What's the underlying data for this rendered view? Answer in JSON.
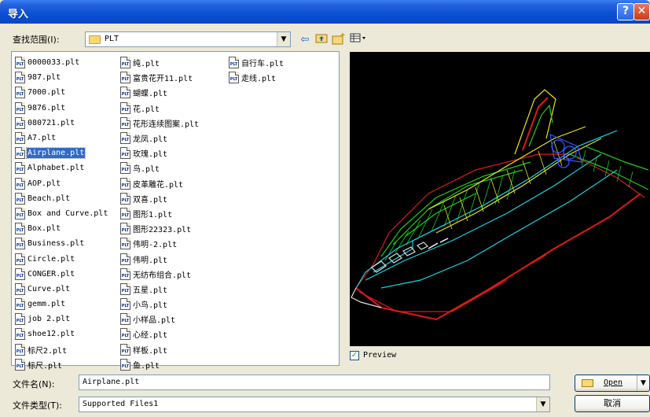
{
  "window": {
    "title": "导入",
    "help_glyph": "?",
    "close_glyph": "✕"
  },
  "lookin": {
    "label": "查找范围(I):",
    "value": "PLT"
  },
  "toolbar": {
    "back_icon": "back-arrow-icon",
    "up_icon": "up-folder-icon",
    "new_folder_icon": "new-folder-icon",
    "view_icon": "view-menu-icon"
  },
  "file_icon_text": "PLT",
  "files": {
    "col1": [
      "0000033.plt",
      "987.plt",
      "7000.plt",
      "9876.plt",
      "080721.plt",
      "A7.plt",
      "Airplane.plt",
      "Alphabet.plt",
      "AOP.plt",
      "Beach.plt",
      "Box and Curve.plt",
      "Box.plt",
      "Business.plt",
      "Circle.plt",
      "CONGER.plt",
      "Curve.plt",
      "gemm.plt",
      "job 2.plt",
      "shoe12.plt",
      "标尺2.plt",
      "标尺.plt"
    ],
    "col2": [
      "纯.plt",
      "富贵花开11.plt",
      "蝴蝶.plt",
      "花.plt",
      "花形连续图案.plt",
      "龙凤.plt",
      "玫瑰.plt",
      "鸟.plt",
      "皮革雕花.plt",
      "双喜.plt",
      "图形1.plt",
      "图形22323.plt",
      "伟明-2.plt",
      "伟明.plt",
      "无纺布组合.plt",
      "五星.plt",
      "小鸟.plt",
      "小样品.plt",
      "心经.plt",
      "样板.plt",
      "鱼.plt"
    ],
    "col3": [
      "自行车.plt",
      "走线.plt"
    ],
    "selected": "Airplane.plt"
  },
  "preview": {
    "checked": true,
    "check_glyph": "✓",
    "label": "Preview"
  },
  "filename": {
    "label": "文件名(N):",
    "value": "Airplane.plt"
  },
  "filetype": {
    "label": "文件类型(T):",
    "value": "Supported Files1"
  },
  "buttons": {
    "open": "Open",
    "cancel": "取消"
  },
  "colors": {
    "title_bar": "#0A4FD3",
    "selection": "#316AC5",
    "preview_bg": "#000000"
  }
}
